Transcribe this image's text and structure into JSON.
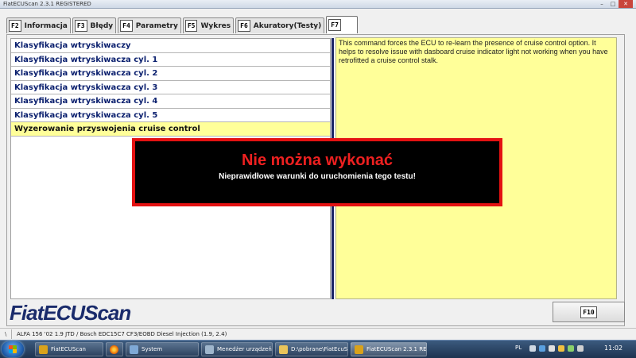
{
  "window": {
    "title": "FiatECUScan 2.3.1 REGISTERED",
    "minimize_glyph": "–",
    "maximize_glyph": "□",
    "close_glyph": "✕"
  },
  "tabs": [
    {
      "key": "F2",
      "label": "Informacja"
    },
    {
      "key": "F3",
      "label": "Błędy"
    },
    {
      "key": "F4",
      "label": "Parametry"
    },
    {
      "key": "F5",
      "label": "Wykres"
    },
    {
      "key": "F6",
      "label": "Akuratory(Testy)"
    },
    {
      "key": "F7",
      "label": ""
    }
  ],
  "test_list": [
    "Klasyfikacja wtryskiwaczy",
    "Klasyfikacja wtryskiwacza cyl. 1",
    "Klasyfikacja wtryskiwacza cyl. 2",
    "Klasyfikacja wtryskiwacza cyl. 3",
    "Klasyfikacja wtryskiwacza cyl. 4",
    "Klasyfikacja wtryskiwacza cyl. 5",
    "Wyzerowanie przyswojenia cruise control"
  ],
  "description": "This command forces the ECU to re-learn the presence of cruise control option. It helps to resolve issue with dasboard cruise indicator light not working when you have retrofitted a cruise control stalk.",
  "error": {
    "title": "Nie można wykonać",
    "message": "Nieprawidłowe warunki do uruchomienia tego testu!"
  },
  "logo_text": "FiatECUScan",
  "f10_label": "F10",
  "status": {
    "slash": "\\",
    "vehicle": "ALFA 156 '02 1.9 JTD / Bosch EDC15C7 CF3/EOBD Diesel Injection (1.9, 2.4)"
  },
  "taskbar": {
    "items": [
      {
        "label": "FiatECUScan",
        "icon": "fiatecuscan-icon",
        "color": "#d9a21b"
      },
      {
        "label": "",
        "icon": "firefox-icon",
        "color": "#e66000"
      },
      {
        "label": "System",
        "icon": "system-icon",
        "color": "#7fa9d6"
      },
      {
        "label": "Menedżer urządzeń",
        "icon": "device-manager-icon",
        "color": "#9fb6cc"
      },
      {
        "label": "D:\\pobrane\\FiatEcuS...",
        "icon": "explorer-icon",
        "color": "#e9c45a"
      },
      {
        "label": "FiatECUScan 2.3.1 RE...",
        "icon": "fiatecuscan-icon",
        "color": "#d9a21b"
      }
    ],
    "language": "PL",
    "clock": "11:02"
  }
}
